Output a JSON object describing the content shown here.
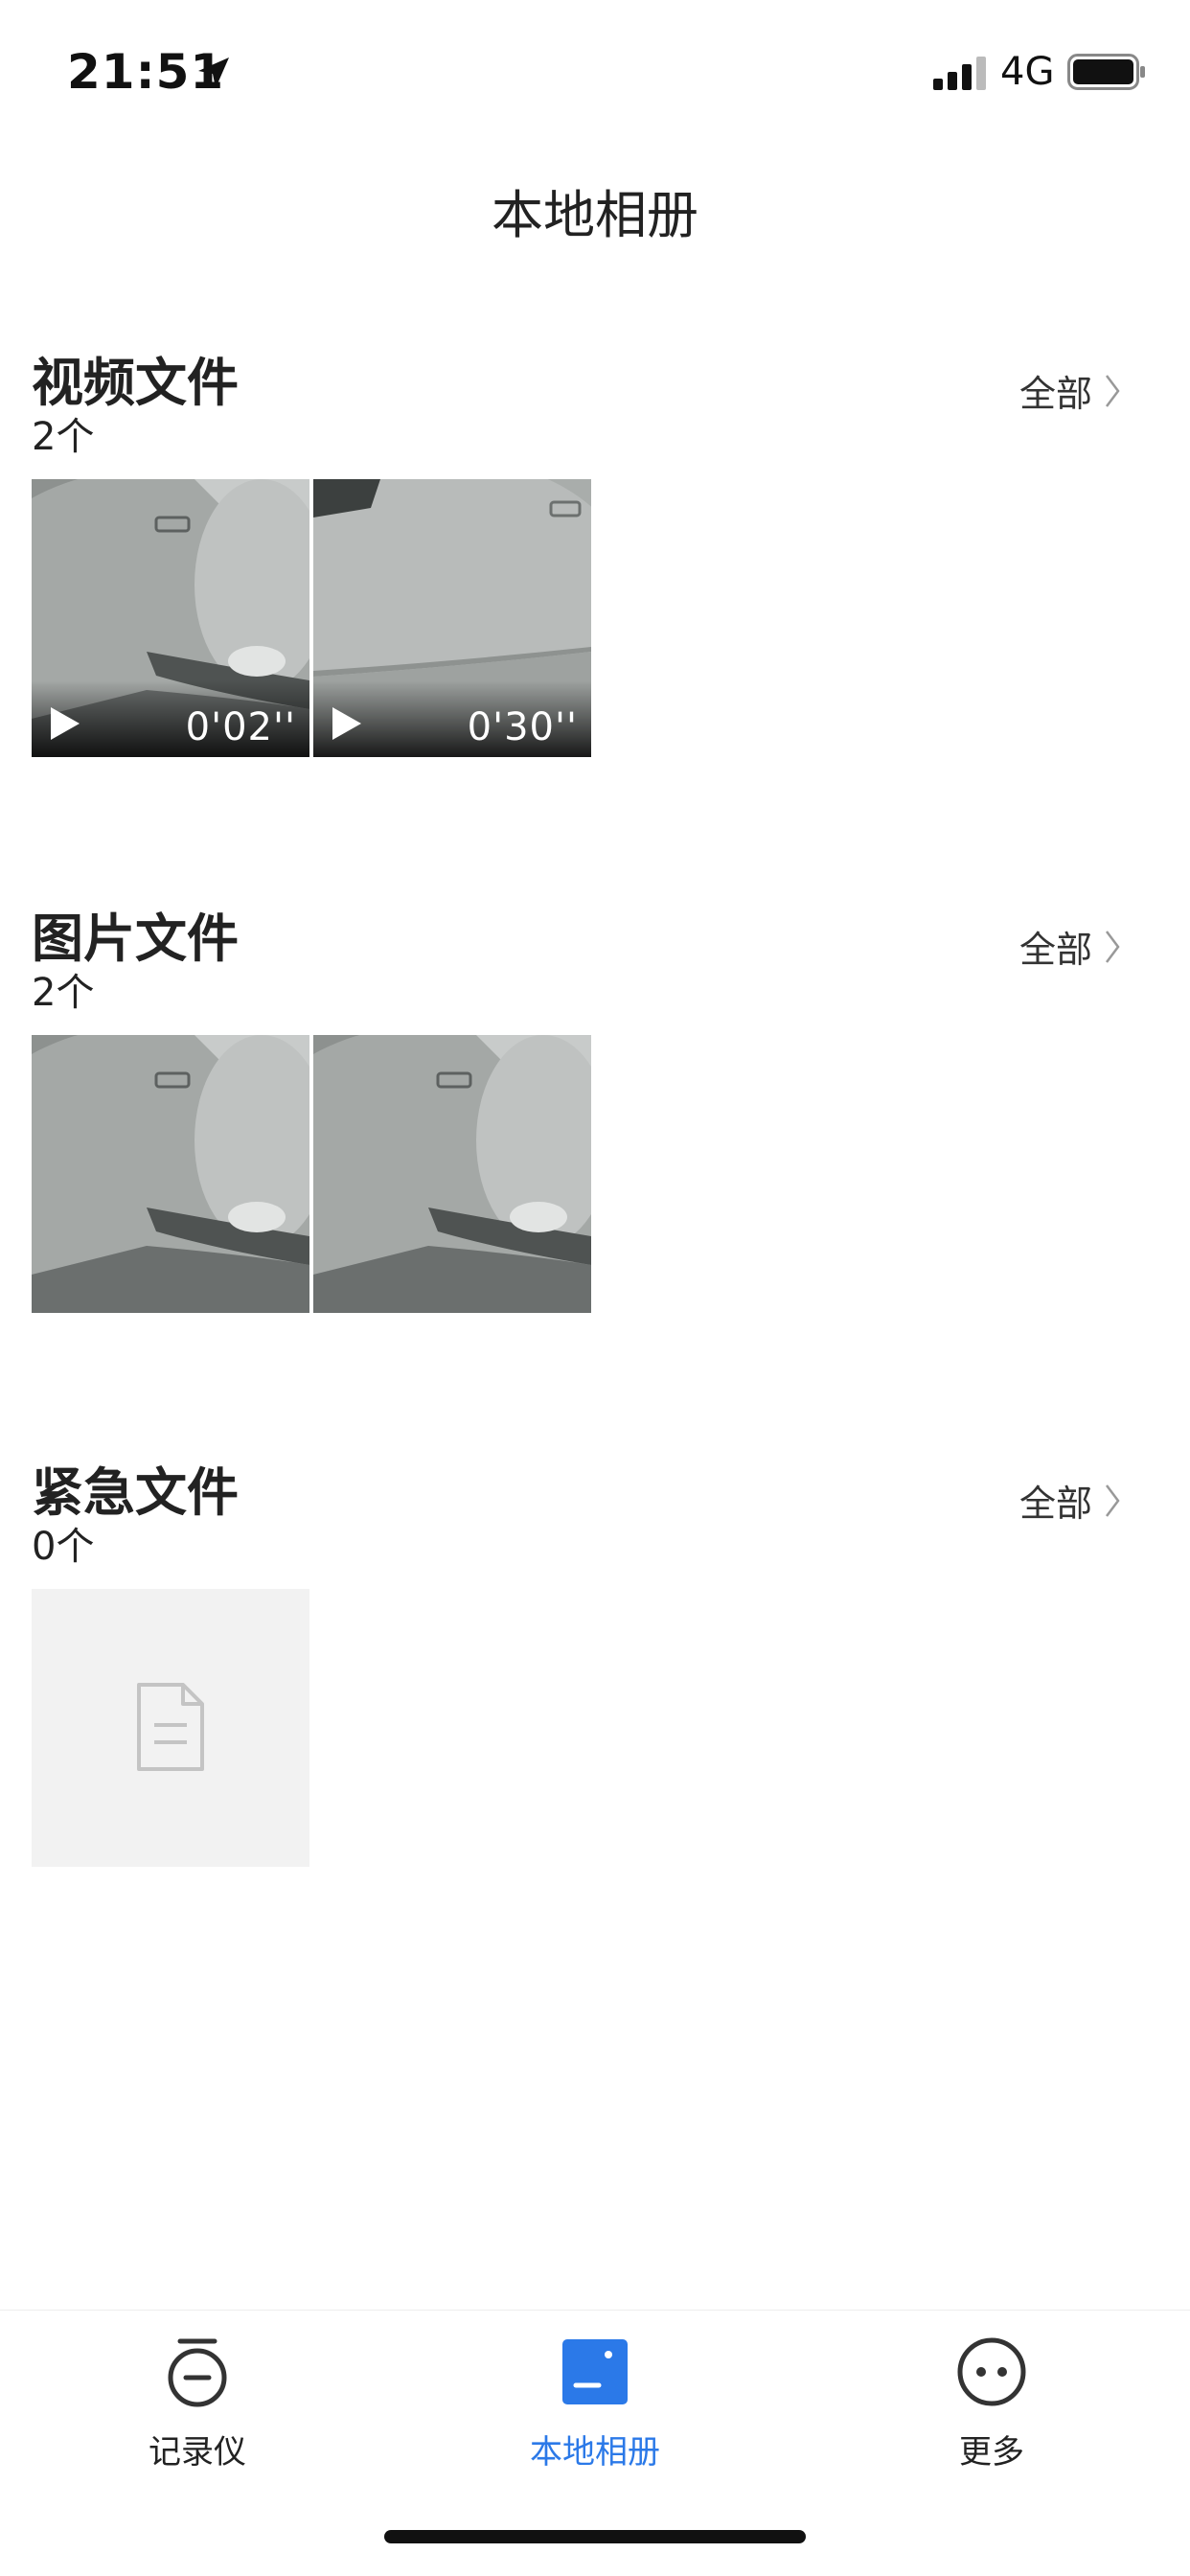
{
  "status_bar": {
    "time": "21:51",
    "network": "4G"
  },
  "nav": {
    "title": "本地相册"
  },
  "sections": [
    {
      "title": "视频文件",
      "count": "2个",
      "all_label": "全部",
      "items": [
        {
          "duration": "0'02''"
        },
        {
          "duration": "0'30''"
        }
      ]
    },
    {
      "title": "图片文件",
      "count": "2个",
      "all_label": "全部"
    },
    {
      "title": "紧急文件",
      "count": "0个",
      "all_label": "全部"
    }
  ],
  "tabs": [
    {
      "label": "记录仪"
    },
    {
      "label": "本地相册"
    },
    {
      "label": "更多"
    }
  ],
  "colors": {
    "accent": "#2b79e8",
    "text": "#222222",
    "empty_bg": "#f2f2f2"
  }
}
